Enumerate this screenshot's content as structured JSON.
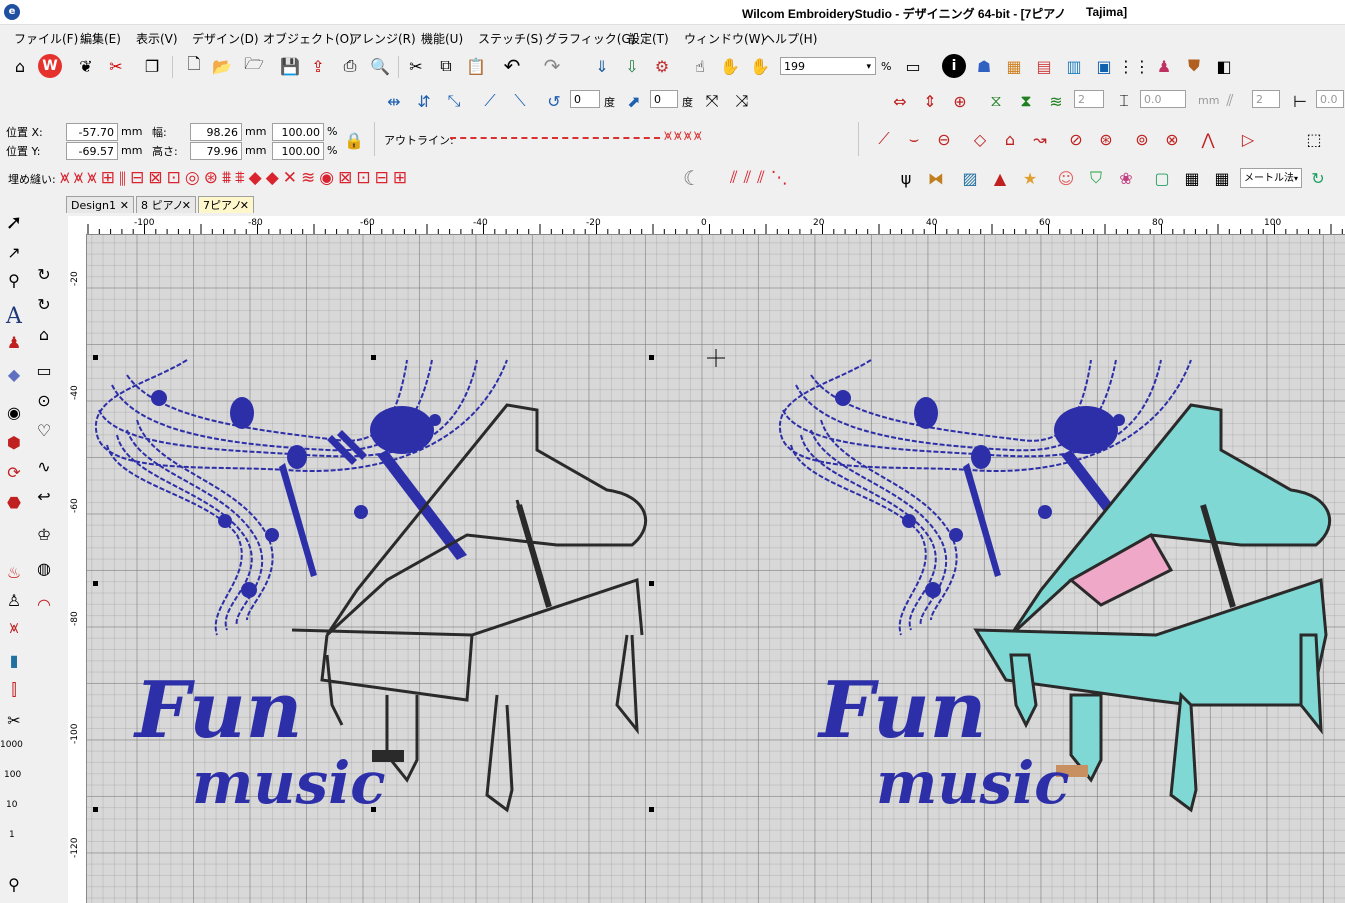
{
  "window": {
    "title": "Wilcom EmbroideryStudio - デザイニング 64-bit - [7ピアノ",
    "machine": "Tajima]",
    "app_icon_label": "e"
  },
  "menu": [
    "ファイル(F)",
    "編集(E)",
    "表示(V)",
    "デザイン(D)",
    "オブジェクト(O)",
    "アレンジ(R)",
    "機能(U)",
    "ステッチ(S)",
    "グラフィック(G)",
    "設定(T)",
    "ウィンドウ(W)",
    "ヘルプ(H)"
  ],
  "toolbar": {
    "zoom_value": "199",
    "zoom_unit": "%",
    "rotate_value": "0",
    "rotate_unit": "度",
    "slant_value": "0",
    "slant_unit": "度",
    "spin1": "2",
    "spin2": "0.0",
    "unit_mm": "mm",
    "spin3": "2",
    "spin4": "0.0"
  },
  "properties": {
    "pos_x_label": "位置 X:",
    "pos_x": "-57.70",
    "pos_y_label": "位置 Y:",
    "pos_y": "-69.57",
    "width_label": "幅:",
    "width": "98.26",
    "height_label": "高さ:",
    "height": "79.96",
    "scale_w": "100.00",
    "scale_h": "100.00",
    "unit": "mm",
    "pct": "%",
    "outline_label": "アウトライン:"
  },
  "fill_bar": {
    "label": "埋め縫い:",
    "units_select": "メートル法"
  },
  "tabs": [
    {
      "label": "Design1",
      "active": false
    },
    {
      "label": "8 ピアノ",
      "active": false
    },
    {
      "label": "7ピアノ",
      "active": true
    }
  ],
  "hruler_labels": [
    "-100",
    "-80",
    "-60",
    "-40",
    "-20",
    "0",
    "20",
    "40",
    "60",
    "80",
    "100"
  ],
  "vruler_labels": [
    "-20",
    "-40",
    "-60",
    "-80",
    "-100",
    "-120"
  ],
  "left_tool_numbers": [
    "1000",
    "100",
    "10",
    "1"
  ],
  "designs": {
    "left_text_line1": "Fun",
    "left_text_line2": "music",
    "right_text_line1": "Fun",
    "right_text_line2": "music"
  },
  "colors": {
    "thread_blue": "#2d2fa8",
    "thread_dark": "#2a2a2a",
    "piano_fill": "#7fd8d4",
    "keys_fill": "#f0a8c8",
    "canvas_bg": "#d8d8d8",
    "accent_red": "#d9232e"
  }
}
